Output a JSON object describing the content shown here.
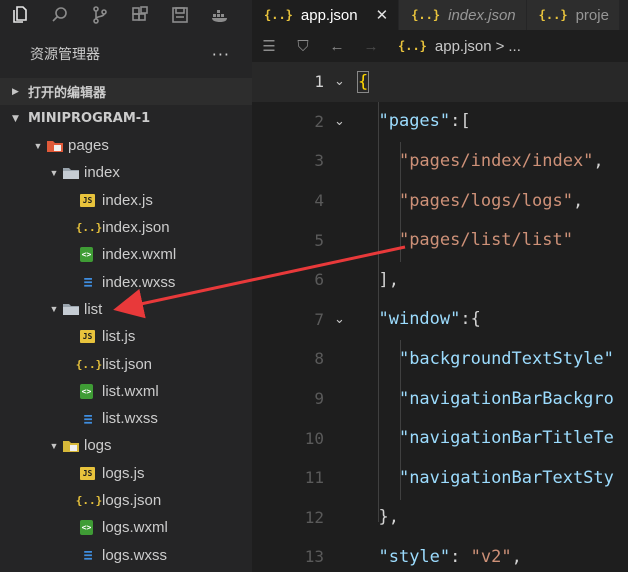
{
  "sidebar": {
    "title": "资源管理器",
    "more": "···",
    "open_editors": "打开的编辑器",
    "project": "MINIPROGRAM-1",
    "tree": [
      {
        "label": "pages",
        "depth": 0,
        "type": "folder-special",
        "expanded": true
      },
      {
        "label": "index",
        "depth": 1,
        "type": "folder",
        "expanded": true
      },
      {
        "label": "index.js",
        "depth": 2,
        "type": "js"
      },
      {
        "label": "index.json",
        "depth": 2,
        "type": "json"
      },
      {
        "label": "index.wxml",
        "depth": 2,
        "type": "wxml"
      },
      {
        "label": "index.wxss",
        "depth": 2,
        "type": "wxss"
      },
      {
        "label": "list",
        "depth": 1,
        "type": "folder",
        "expanded": true
      },
      {
        "label": "list.js",
        "depth": 2,
        "type": "js"
      },
      {
        "label": "list.json",
        "depth": 2,
        "type": "json"
      },
      {
        "label": "list.wxml",
        "depth": 2,
        "type": "wxml"
      },
      {
        "label": "list.wxss",
        "depth": 2,
        "type": "wxss"
      },
      {
        "label": "logs",
        "depth": 1,
        "type": "folder-special",
        "expanded": true
      },
      {
        "label": "logs.js",
        "depth": 2,
        "type": "js"
      },
      {
        "label": "logs.json",
        "depth": 2,
        "type": "json"
      },
      {
        "label": "logs.wxml",
        "depth": 2,
        "type": "wxml"
      },
      {
        "label": "logs.wxss",
        "depth": 2,
        "type": "wxss"
      }
    ]
  },
  "tabs": [
    {
      "label": "app.json",
      "icon": "{..}",
      "active": true,
      "close": "✕"
    },
    {
      "label": "index.json",
      "icon": "{..}",
      "active": false
    },
    {
      "label": "proje",
      "icon": "{..}",
      "active": false
    }
  ],
  "breadcrumb": {
    "file": "app.json",
    "icon": "{..}",
    "sep": ">",
    "tail": "..."
  },
  "editor": {
    "lines": [
      {
        "n": "1",
        "tokens": [
          {
            "t": "{",
            "c": "brace"
          }
        ],
        "fold": true,
        "current": true
      },
      {
        "n": "2",
        "tokens": [
          {
            "t": "  "
          },
          {
            "t": "\"pages\"",
            "c": "key"
          },
          {
            "t": ":[",
            "c": "punct"
          }
        ],
        "fold": true
      },
      {
        "n": "3",
        "tokens": [
          {
            "t": "    "
          },
          {
            "t": "\"pages/index/index\"",
            "c": "str"
          },
          {
            "t": ",",
            "c": "punct"
          }
        ]
      },
      {
        "n": "4",
        "tokens": [
          {
            "t": "    "
          },
          {
            "t": "\"pages/logs/logs\"",
            "c": "str"
          },
          {
            "t": ",",
            "c": "punct"
          }
        ]
      },
      {
        "n": "5",
        "tokens": [
          {
            "t": "    "
          },
          {
            "t": "\"pages/list/list\"",
            "c": "str"
          }
        ]
      },
      {
        "n": "6",
        "tokens": [
          {
            "t": "  "
          },
          {
            "t": "],",
            "c": "punct"
          }
        ]
      },
      {
        "n": "7",
        "tokens": [
          {
            "t": "  "
          },
          {
            "t": "\"window\"",
            "c": "key"
          },
          {
            "t": ":{",
            "c": "punct"
          }
        ],
        "fold": true
      },
      {
        "n": "8",
        "tokens": [
          {
            "t": "    "
          },
          {
            "t": "\"backgroundTextStyle\"",
            "c": "key"
          }
        ]
      },
      {
        "n": "9",
        "tokens": [
          {
            "t": "    "
          },
          {
            "t": "\"navigationBarBackgro",
            "c": "key"
          }
        ]
      },
      {
        "n": "10",
        "tokens": [
          {
            "t": "    "
          },
          {
            "t": "\"navigationBarTitleTe",
            "c": "key"
          }
        ]
      },
      {
        "n": "11",
        "tokens": [
          {
            "t": "    "
          },
          {
            "t": "\"navigationBarTextSty",
            "c": "key"
          }
        ]
      },
      {
        "n": "12",
        "tokens": [
          {
            "t": "  "
          },
          {
            "t": "},",
            "c": "punct"
          }
        ]
      },
      {
        "n": "13",
        "tokens": [
          {
            "t": "  "
          },
          {
            "t": "\"style\"",
            "c": "key"
          },
          {
            "t": ": ",
            "c": "punct"
          },
          {
            "t": "\"v2\"",
            "c": "str"
          },
          {
            "t": ",",
            "c": "punct"
          }
        ]
      }
    ]
  },
  "colors": {
    "annotation_arrow": "#e8393a",
    "json_icon": "#e8c33c",
    "key": "#9cdcfe",
    "string": "#ce9178"
  }
}
